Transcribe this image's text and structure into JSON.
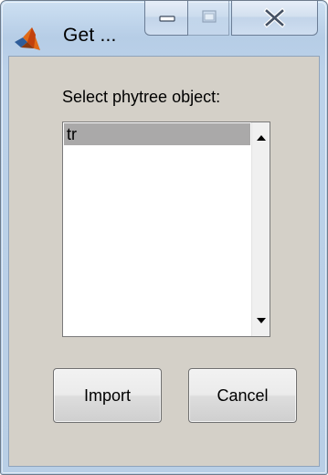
{
  "window": {
    "title": "Get ...",
    "caption_buttons": [
      "minimize",
      "maximize",
      "close"
    ],
    "maximize_disabled": true
  },
  "dialog": {
    "prompt": "Select phytree object:",
    "list_items": [
      "tr"
    ],
    "selected_item": "tr",
    "import_label": "Import",
    "cancel_label": "Cancel"
  },
  "icons": {
    "app": "matlab-icon",
    "minimize": "minimize-icon",
    "maximize": "maximize-icon",
    "close": "close-icon",
    "scroll_up": "scroll-up-arrow-icon",
    "scroll_down": "scroll-down-arrow-icon"
  },
  "colors": {
    "client_background": "#d4d0c8",
    "selection": "#aaa9a9",
    "frame": "#b9cfe6"
  }
}
